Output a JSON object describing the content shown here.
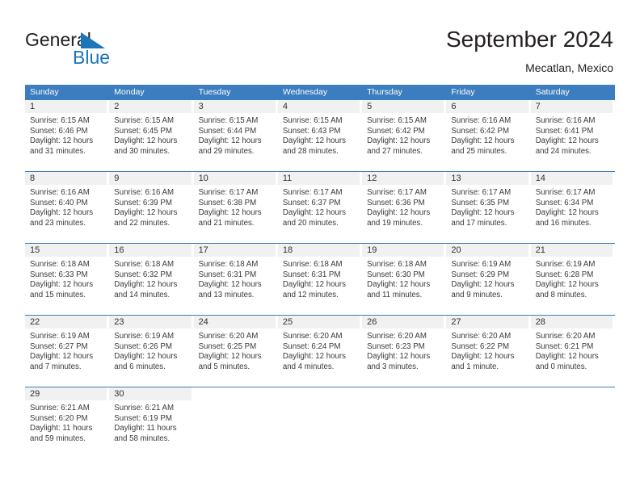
{
  "brand": {
    "name_part1": "General",
    "name_part2": "Blue",
    "triangle_icon": "blue-triangle-icon",
    "accent_color": "#1b75bb"
  },
  "header": {
    "title": "September 2024",
    "subtitle": "Mecatlan, Mexico"
  },
  "colors": {
    "header_blue": "#3b7dbe",
    "daynum_gray": "#f1f1f1",
    "text": "#3a3a3a"
  },
  "calendar": {
    "day_names": [
      "Sunday",
      "Monday",
      "Tuesday",
      "Wednesday",
      "Thursday",
      "Friday",
      "Saturday"
    ],
    "weeks": [
      [
        {
          "day": "1",
          "sunrise": "Sunrise: 6:15 AM",
          "sunset": "Sunset: 6:46 PM",
          "daylight1": "Daylight: 12 hours",
          "daylight2": "and 31 minutes."
        },
        {
          "day": "2",
          "sunrise": "Sunrise: 6:15 AM",
          "sunset": "Sunset: 6:45 PM",
          "daylight1": "Daylight: 12 hours",
          "daylight2": "and 30 minutes."
        },
        {
          "day": "3",
          "sunrise": "Sunrise: 6:15 AM",
          "sunset": "Sunset: 6:44 PM",
          "daylight1": "Daylight: 12 hours",
          "daylight2": "and 29 minutes."
        },
        {
          "day": "4",
          "sunrise": "Sunrise: 6:15 AM",
          "sunset": "Sunset: 6:43 PM",
          "daylight1": "Daylight: 12 hours",
          "daylight2": "and 28 minutes."
        },
        {
          "day": "5",
          "sunrise": "Sunrise: 6:15 AM",
          "sunset": "Sunset: 6:42 PM",
          "daylight1": "Daylight: 12 hours",
          "daylight2": "and 27 minutes."
        },
        {
          "day": "6",
          "sunrise": "Sunrise: 6:16 AM",
          "sunset": "Sunset: 6:42 PM",
          "daylight1": "Daylight: 12 hours",
          "daylight2": "and 25 minutes."
        },
        {
          "day": "7",
          "sunrise": "Sunrise: 6:16 AM",
          "sunset": "Sunset: 6:41 PM",
          "daylight1": "Daylight: 12 hours",
          "daylight2": "and 24 minutes."
        }
      ],
      [
        {
          "day": "8",
          "sunrise": "Sunrise: 6:16 AM",
          "sunset": "Sunset: 6:40 PM",
          "daylight1": "Daylight: 12 hours",
          "daylight2": "and 23 minutes."
        },
        {
          "day": "9",
          "sunrise": "Sunrise: 6:16 AM",
          "sunset": "Sunset: 6:39 PM",
          "daylight1": "Daylight: 12 hours",
          "daylight2": "and 22 minutes."
        },
        {
          "day": "10",
          "sunrise": "Sunrise: 6:17 AM",
          "sunset": "Sunset: 6:38 PM",
          "daylight1": "Daylight: 12 hours",
          "daylight2": "and 21 minutes."
        },
        {
          "day": "11",
          "sunrise": "Sunrise: 6:17 AM",
          "sunset": "Sunset: 6:37 PM",
          "daylight1": "Daylight: 12 hours",
          "daylight2": "and 20 minutes."
        },
        {
          "day": "12",
          "sunrise": "Sunrise: 6:17 AM",
          "sunset": "Sunset: 6:36 PM",
          "daylight1": "Daylight: 12 hours",
          "daylight2": "and 19 minutes."
        },
        {
          "day": "13",
          "sunrise": "Sunrise: 6:17 AM",
          "sunset": "Sunset: 6:35 PM",
          "daylight1": "Daylight: 12 hours",
          "daylight2": "and 17 minutes."
        },
        {
          "day": "14",
          "sunrise": "Sunrise: 6:17 AM",
          "sunset": "Sunset: 6:34 PM",
          "daylight1": "Daylight: 12 hours",
          "daylight2": "and 16 minutes."
        }
      ],
      [
        {
          "day": "15",
          "sunrise": "Sunrise: 6:18 AM",
          "sunset": "Sunset: 6:33 PM",
          "daylight1": "Daylight: 12 hours",
          "daylight2": "and 15 minutes."
        },
        {
          "day": "16",
          "sunrise": "Sunrise: 6:18 AM",
          "sunset": "Sunset: 6:32 PM",
          "daylight1": "Daylight: 12 hours",
          "daylight2": "and 14 minutes."
        },
        {
          "day": "17",
          "sunrise": "Sunrise: 6:18 AM",
          "sunset": "Sunset: 6:31 PM",
          "daylight1": "Daylight: 12 hours",
          "daylight2": "and 13 minutes."
        },
        {
          "day": "18",
          "sunrise": "Sunrise: 6:18 AM",
          "sunset": "Sunset: 6:31 PM",
          "daylight1": "Daylight: 12 hours",
          "daylight2": "and 12 minutes."
        },
        {
          "day": "19",
          "sunrise": "Sunrise: 6:18 AM",
          "sunset": "Sunset: 6:30 PM",
          "daylight1": "Daylight: 12 hours",
          "daylight2": "and 11 minutes."
        },
        {
          "day": "20",
          "sunrise": "Sunrise: 6:19 AM",
          "sunset": "Sunset: 6:29 PM",
          "daylight1": "Daylight: 12 hours",
          "daylight2": "and 9 minutes."
        },
        {
          "day": "21",
          "sunrise": "Sunrise: 6:19 AM",
          "sunset": "Sunset: 6:28 PM",
          "daylight1": "Daylight: 12 hours",
          "daylight2": "and 8 minutes."
        }
      ],
      [
        {
          "day": "22",
          "sunrise": "Sunrise: 6:19 AM",
          "sunset": "Sunset: 6:27 PM",
          "daylight1": "Daylight: 12 hours",
          "daylight2": "and 7 minutes."
        },
        {
          "day": "23",
          "sunrise": "Sunrise: 6:19 AM",
          "sunset": "Sunset: 6:26 PM",
          "daylight1": "Daylight: 12 hours",
          "daylight2": "and 6 minutes."
        },
        {
          "day": "24",
          "sunrise": "Sunrise: 6:20 AM",
          "sunset": "Sunset: 6:25 PM",
          "daylight1": "Daylight: 12 hours",
          "daylight2": "and 5 minutes."
        },
        {
          "day": "25",
          "sunrise": "Sunrise: 6:20 AM",
          "sunset": "Sunset: 6:24 PM",
          "daylight1": "Daylight: 12 hours",
          "daylight2": "and 4 minutes."
        },
        {
          "day": "26",
          "sunrise": "Sunrise: 6:20 AM",
          "sunset": "Sunset: 6:23 PM",
          "daylight1": "Daylight: 12 hours",
          "daylight2": "and 3 minutes."
        },
        {
          "day": "27",
          "sunrise": "Sunrise: 6:20 AM",
          "sunset": "Sunset: 6:22 PM",
          "daylight1": "Daylight: 12 hours",
          "daylight2": "and 1 minute."
        },
        {
          "day": "28",
          "sunrise": "Sunrise: 6:20 AM",
          "sunset": "Sunset: 6:21 PM",
          "daylight1": "Daylight: 12 hours",
          "daylight2": "and 0 minutes."
        }
      ],
      [
        {
          "day": "29",
          "sunrise": "Sunrise: 6:21 AM",
          "sunset": "Sunset: 6:20 PM",
          "daylight1": "Daylight: 11 hours",
          "daylight2": "and 59 minutes."
        },
        {
          "day": "30",
          "sunrise": "Sunrise: 6:21 AM",
          "sunset": "Sunset: 6:19 PM",
          "daylight1": "Daylight: 11 hours",
          "daylight2": "and 58 minutes."
        },
        {
          "day": "",
          "sunrise": "",
          "sunset": "",
          "daylight1": "",
          "daylight2": ""
        },
        {
          "day": "",
          "sunrise": "",
          "sunset": "",
          "daylight1": "",
          "daylight2": ""
        },
        {
          "day": "",
          "sunrise": "",
          "sunset": "",
          "daylight1": "",
          "daylight2": ""
        },
        {
          "day": "",
          "sunrise": "",
          "sunset": "",
          "daylight1": "",
          "daylight2": ""
        },
        {
          "day": "",
          "sunrise": "",
          "sunset": "",
          "daylight1": "",
          "daylight2": ""
        }
      ]
    ]
  }
}
